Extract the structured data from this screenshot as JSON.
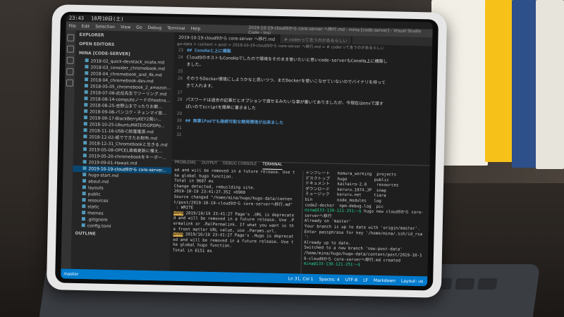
{
  "status_bar_top": {
    "time": "23:43",
    "date": "10月10日(土)"
  },
  "window_title": "2019-10-19-cloud9から core-server へ移行.md - mina [code-server] - Visual Studio Code - Insi",
  "menu": [
    "File",
    "Edit",
    "Selection",
    "View",
    "Go",
    "Debug",
    "Terminal",
    "Help"
  ],
  "sidebar": {
    "explorer_label": "EXPLORER",
    "open_editors_label": "OPEN EDITORS",
    "project_label": "MINA [CODE-SERVER]",
    "files": [
      "2018-02_quick-devstack_ocata.md",
      "2018-03_consider_chromebook.md",
      "2018-04_chromebook_and_4k.md",
      "2018-04_chromebook-dev.md",
      "2018-05-05_chromebook_2_amazon...",
      "2018-07-08-此任先生でツーリング.md",
      "2018-08-14-computeノードのhostna...",
      "2018-08-25-吉野山までったりお散...",
      "2018-09-08-パンコク・チェンマイ旅...",
      "2018-09-17-BlackBerryKEY2買い...",
      "2018-10-25-UbuntuMATEのGPDPo...",
      "2018-11-16-USB-C給電電源.md",
      "2018-12-02-紙でできたお財布.md",
      "2018-12-31_Chromebookと生きる.md",
      "2019-05-08-OPCEL資格更新に備え...",
      "2019-05-20-chromebookをキーボー...",
      "2019-09-01-Hawaii.md",
      "2019-10-19-cloud9から core-server...",
      "hugo-start.md",
      "about.md",
      "layouts",
      "public",
      "resources",
      "static",
      "themes",
      ".gitignore",
      "config.toml"
    ],
    "outline_label": "OUTLINE"
  },
  "tabs": [
    "2019-10-19-cloud9から core-server へ移行.md",
    "# coderって言うのがあるらしい"
  ],
  "breadcrumbs": "go-data > content > post > 2019-10-19-cloud9から core-server へ移行.md > # coderって言うのがあるらしい",
  "editor_lines": [
    {
      "n": "23",
      "text": "## ConoHaと上に構築",
      "cls": "h2"
    },
    {
      "n": "24",
      "text": "Cloud9のホストもConoHaでしたので環境をそのまま使いたいと思いcode-serverもConoHa上に構築し",
      "cls": ""
    },
    {
      "n": "",
      "text": "ました。",
      "cls": ""
    },
    {
      "n": "25",
      "text": "",
      "cls": ""
    },
    {
      "n": "26",
      "text": "そのうちDocker環境にしようかなと思いつつ、まだDockerを使いこなせていないのでバイナリを持って",
      "cls": ""
    },
    {
      "n": "",
      "text": "きて入れます。",
      "cls": ""
    },
    {
      "n": "27",
      "text": "",
      "cls": ""
    },
    {
      "n": "28",
      "text": "パスワードは過去の記事だとオプションで渡せるみたいな事が書いてありましたが、今現在はenvで渡す",
      "cls": ""
    },
    {
      "n": "",
      "text": "ぱいのでscriptを簡単に書きました",
      "cls": ""
    },
    {
      "n": "29",
      "text": "",
      "cls": ""
    },
    {
      "n": "30",
      "text": "## 無事iPadでも接続可能な開発環境が出来ました",
      "cls": "h2"
    },
    {
      "n": "31",
      "text": "",
      "cls": ""
    },
    {
      "n": "32",
      "text": "",
      "cls": ""
    }
  ],
  "panel_tabs": [
    "PROBLEMS",
    "OUTPUT",
    "DEBUG CONSOLE",
    "TERMINAL"
  ],
  "terminal_left": [
    "ed and will be removed in a future release. Use t",
    "he global hugo function.",
    "Total in 9687 ms",
    "",
    "Change detected, rebuilding site.",
    "2019-10-19 23:41:27.352 +0900",
    "Source changed \"/home/mina/hugo/hugo-data/conten",
    "t/post/2019-10-19-cloud9から core-serverへ移行.md\"",
    " : WRITE",
    "WARN 2019/10/19 23:41:27 Page's .URL is deprecate",
    "d and will be removed in a future release. Use .P",
    "ermalink or .RelPermalink. If what you want is th",
    "e front matter URL value, use .Params.url.",
    "WARN 2019/10/19 23:41:27 Page's .Hugo is deprecat",
    "ed and will be removed in a future release. Use t",
    "he global hugo function.",
    "Total in 6151 ms"
  ],
  "terminal_right": [
    "テンプレート   homura_working  projects",
    "デスクトップ   hugo           public",
    "ドキュメント   kaitairo-2.0    resources",
    "ダウンロード   keruru.1974.JP  snap",
    "ミュージック   keruru.net     tiara",
    "bin          node_modules   log",
    "code2-docker  npm-debug.log  pic",
    "mina@133-130-121-251:~$ hugo new cloud9から core-",
    "serverへ移行",
    "Already on 'master'",
    "Your branch is up to date with 'origin/master'.",
    "Enter passphrase for key '/home/mina/.ssh/id_rsa",
    "':",
    "Already up to date.",
    "Switched to a new branch 'new-post-data'",
    "/home/mina/hugo/hugo-data/content/post/2019-10-1",
    "9-cloud9から core-serverへ移行.md created",
    "mina@133-130-121-251:~$ "
  ],
  "statusbar": {
    "branch": "master",
    "position": "Ln 31, Col 1",
    "spaces": "Spaces: 4",
    "encoding": "UTF-8",
    "eol": "LF",
    "lang": "Markdown",
    "layout": "Layout: us"
  }
}
